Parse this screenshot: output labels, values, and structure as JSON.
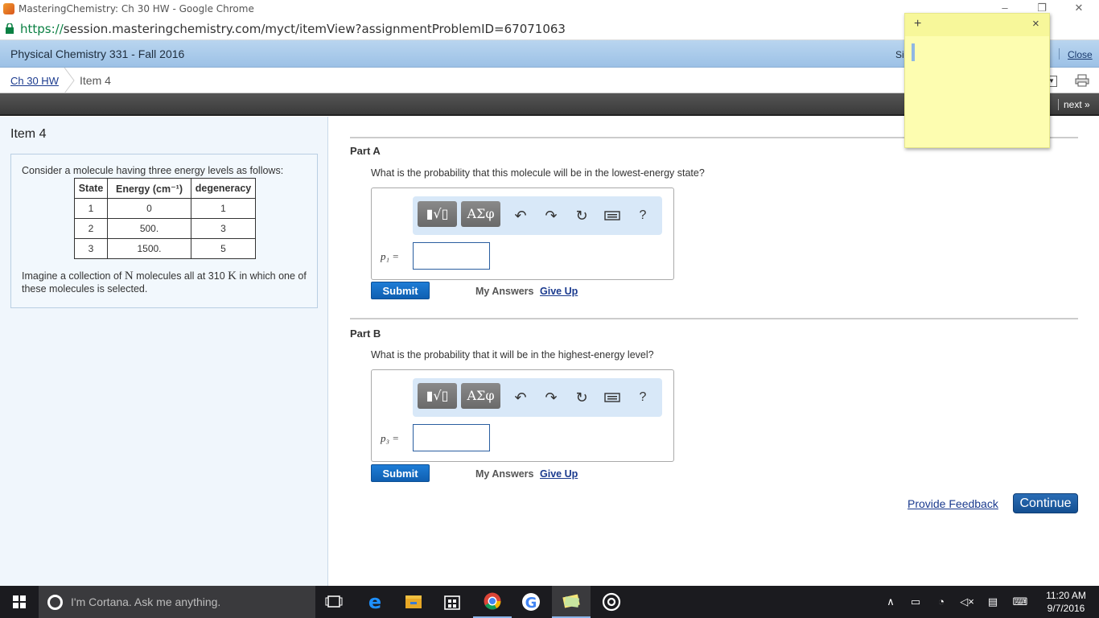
{
  "window": {
    "title": "MasteringChemistry: Ch 30 HW - Google Chrome",
    "url_scheme": "https://",
    "url_rest": "session.masteringchemistry.com/myct/itemView?assignmentProblemID=67071063"
  },
  "coursebar": {
    "course": "Physical Chemistry 331 - Fall 2016",
    "signout_partial": "Si",
    "close": "Close"
  },
  "breadcrumb": {
    "chapter": "Ch 30 HW",
    "item": "Item 4"
  },
  "nav": {
    "next": "next »"
  },
  "left": {
    "heading": "Item 4",
    "intro": "Consider a molecule having three energy levels as follows:",
    "table": {
      "headers": [
        "State",
        "Energy (cm⁻¹)",
        "degeneracy"
      ],
      "rows": [
        [
          "1",
          "0",
          "1"
        ],
        [
          "2",
          "500.",
          "3"
        ],
        [
          "3",
          "1500.",
          "5"
        ]
      ]
    },
    "outro_a": "Imagine a collection of ",
    "outro_n": "N",
    "outro_b": " molecules all at 310 ",
    "outro_k": "K",
    "outro_c": " in which one of these molecules is selected."
  },
  "parts": [
    {
      "title": "Part A",
      "question": "What is the probability that this molecule will be in the lowest-energy state?",
      "variable": "p₁",
      "equals": "=",
      "submit": "Submit",
      "my_answers": "My Answers",
      "give_up": "Give Up"
    },
    {
      "title": "Part B",
      "question": "What is the probability that it will be in the highest-energy level?",
      "variable": "p₃",
      "equals": "=",
      "submit": "Submit",
      "my_answers": "My Answers",
      "give_up": "Give Up"
    }
  ],
  "toolbar": {
    "template": "▮√▯",
    "greek": "ΑΣφ",
    "undo": "↶",
    "redo": "↷",
    "reset": "↻",
    "help": "?"
  },
  "footer": {
    "feedback": "Provide Feedback",
    "continue": "Continue"
  },
  "sticky": {
    "plus": "+",
    "close": "×"
  },
  "taskbar": {
    "cortana": "I'm Cortana. Ask me anything.",
    "time": "11:20 AM",
    "date": "9/7/2016"
  }
}
